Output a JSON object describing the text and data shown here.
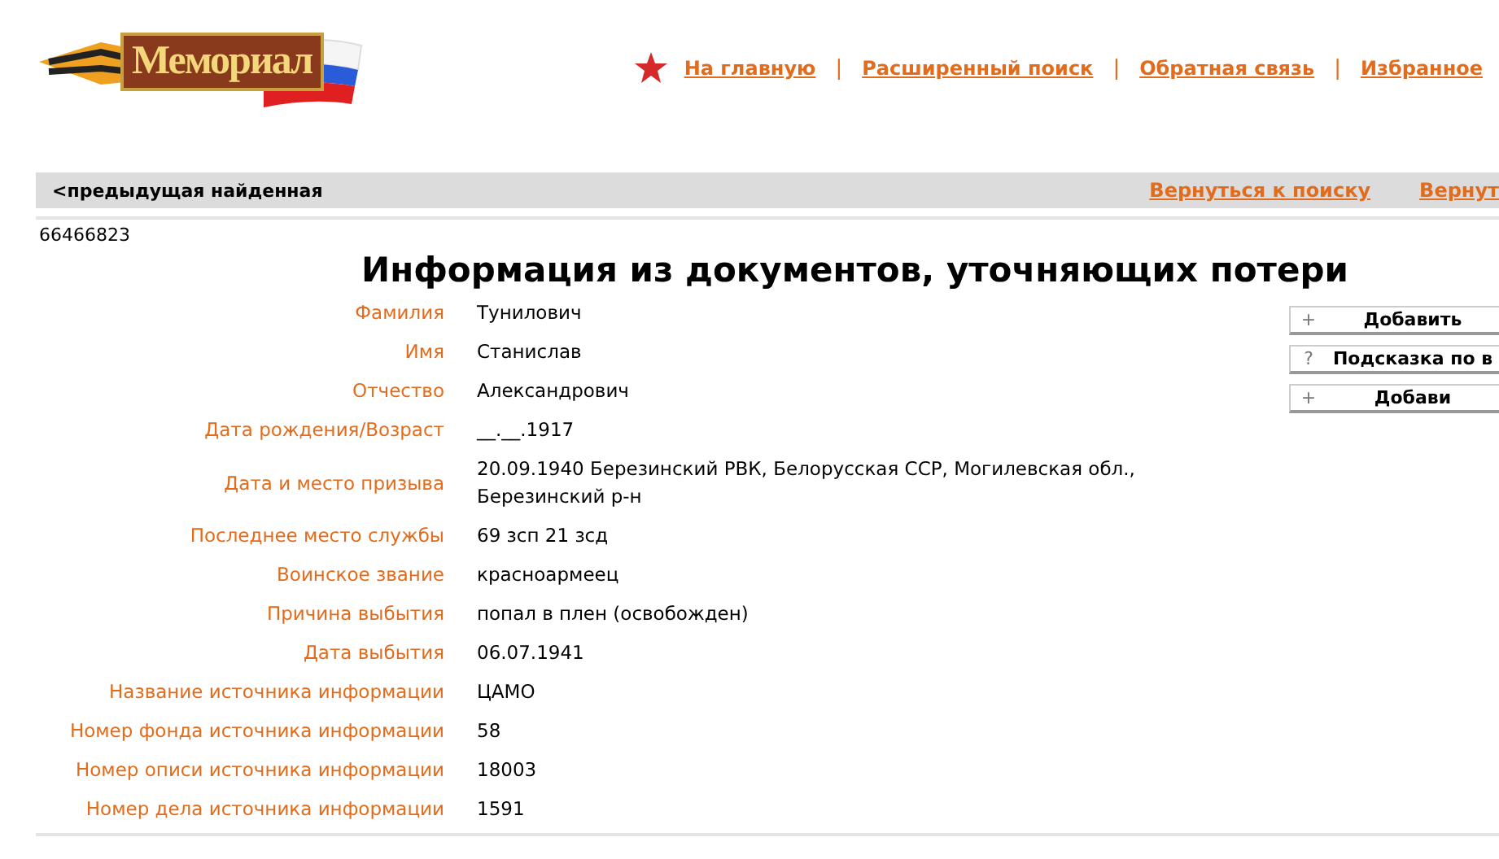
{
  "logo": {
    "text": "Мемориал"
  },
  "nav": [
    "На главную",
    "Расширенный поиск",
    "Обратная связь",
    "Избранное"
  ],
  "nav_separator": "|",
  "result_bar": {
    "previous": "<предыдущая найденная",
    "links": [
      "Вернуться к поиску",
      "Вернут"
    ]
  },
  "record_id": "66466823",
  "title": "Информация из документов, уточняющих потери",
  "fields": [
    {
      "label": "Фамилия",
      "value": "Тунилович"
    },
    {
      "label": "Имя",
      "value": "Станислав"
    },
    {
      "label": "Отчество",
      "value": "Александрович"
    },
    {
      "label": "Дата рождения/Возраст",
      "value": "__.__.1917"
    },
    {
      "label": "Дата и место призыва",
      "value": "20.09.1940 Березинский РВК, Белорусская ССР, Могилевская обл., Березинский р-н"
    },
    {
      "label": "Последнее место службы",
      "value": "69 зсп 21 зсд"
    },
    {
      "label": "Воинское звание",
      "value": "красноармеец"
    },
    {
      "label": "Причина выбытия",
      "value": "попал в плен (освобожден)"
    },
    {
      "label": "Дата выбытия",
      "value": "06.07.1941"
    },
    {
      "label": "Название источника информации",
      "value": "ЦАМО"
    },
    {
      "label": "Номер фонда источника информации",
      "value": "58"
    },
    {
      "label": "Номер описи источника информации",
      "value": "18003"
    },
    {
      "label": "Номер дела источника информации",
      "value": "1591"
    }
  ],
  "side_buttons": [
    {
      "symbol": "+",
      "label": "Добавить"
    },
    {
      "symbol": "?",
      "label": "Подсказка по в"
    },
    {
      "symbol": "+",
      "label": "Добави"
    }
  ]
}
